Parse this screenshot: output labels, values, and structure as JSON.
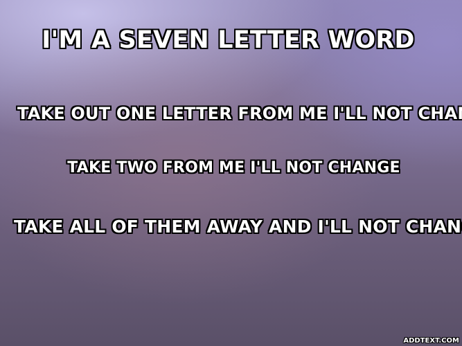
{
  "meme": {
    "title": "I'M A SEVEN LETTER WORD",
    "line1": "TAKE OUT ONE LETTER FROM ME I'LL NOT CHANGE",
    "line2": "TAKE TWO FROM ME I'LL NOT CHANGE",
    "line3": "TAKE ALL OF THEM AWAY AND I'LL NOT CHANGE"
  },
  "watermark": "ADDTEXT.COM",
  "colors": {
    "text": "#ffffff",
    "outline": "#000000",
    "background_top": "#c8c3eb",
    "background_bottom": "#5a5068"
  }
}
